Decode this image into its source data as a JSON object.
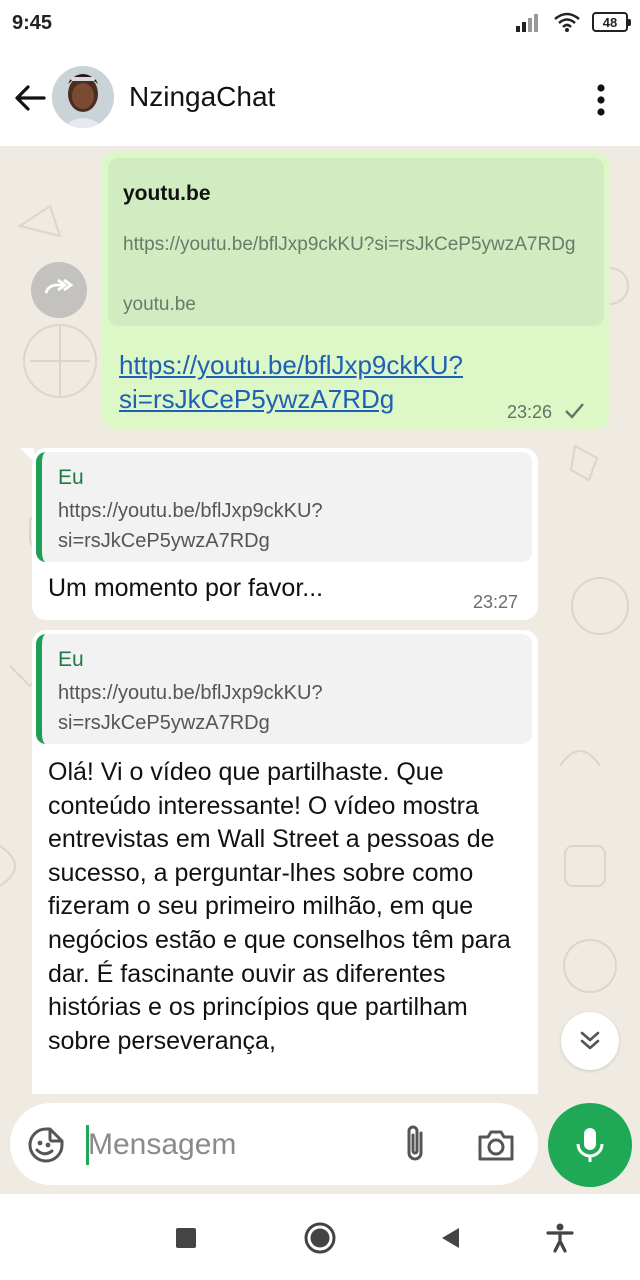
{
  "status_bar": {
    "time": "9:45",
    "battery": "48"
  },
  "header": {
    "contact_name": "NzingaChat"
  },
  "messages": {
    "outgoing": {
      "link_preview": {
        "title": "youtu.be",
        "url": "https://youtu.be/bflJxp9ckKU?si=rsJkCeP5ywzA7RDg",
        "domain": "youtu.be"
      },
      "link_text": "https://youtu.be/bflJxp9ckKU?si=rsJkCeP5ywzA7RDg",
      "time": "23:26"
    },
    "incoming": [
      {
        "quote_author": "Eu",
        "quote_text": "https://youtu.be/bflJxp9ckKU?si=rsJkCeP5ywzA7RDg",
        "text": "Um momento por favor...",
        "time": "23:27"
      },
      {
        "quote_author": "Eu",
        "quote_text": "https://youtu.be/bflJxp9ckKU?si=rsJkCeP5ywzA7RDg",
        "text": "Olá! Vi o vídeo que partilhaste. Que conteúdo interessante! O vídeo mostra entrevistas em Wall Street a pessoas de sucesso, a perguntar-lhes sobre como fizeram o seu primeiro milhão, em que negócios estão e que conselhos têm para dar. É fascinante ouvir as diferentes histórias e os princípios que partilham sobre perseverança,"
      }
    ]
  },
  "input": {
    "placeholder": "Mensagem"
  },
  "colors": {
    "accent": "#1fa855",
    "outgoing_bubble": "#dcf8c6",
    "link": "#1f5fb8",
    "chat_bg": "#efeae2"
  },
  "icons": {
    "header": [
      "back-arrow-icon",
      "more-vert-icon"
    ],
    "chat": [
      "forward-icon",
      "check-icon",
      "chevron-double-down-icon"
    ],
    "input": [
      "sticker-icon",
      "paperclip-icon",
      "camera-icon",
      "mic-icon"
    ],
    "nav": [
      "stop-square-icon",
      "home-circle-icon",
      "back-triangle-icon",
      "accessibility-icon"
    ]
  }
}
